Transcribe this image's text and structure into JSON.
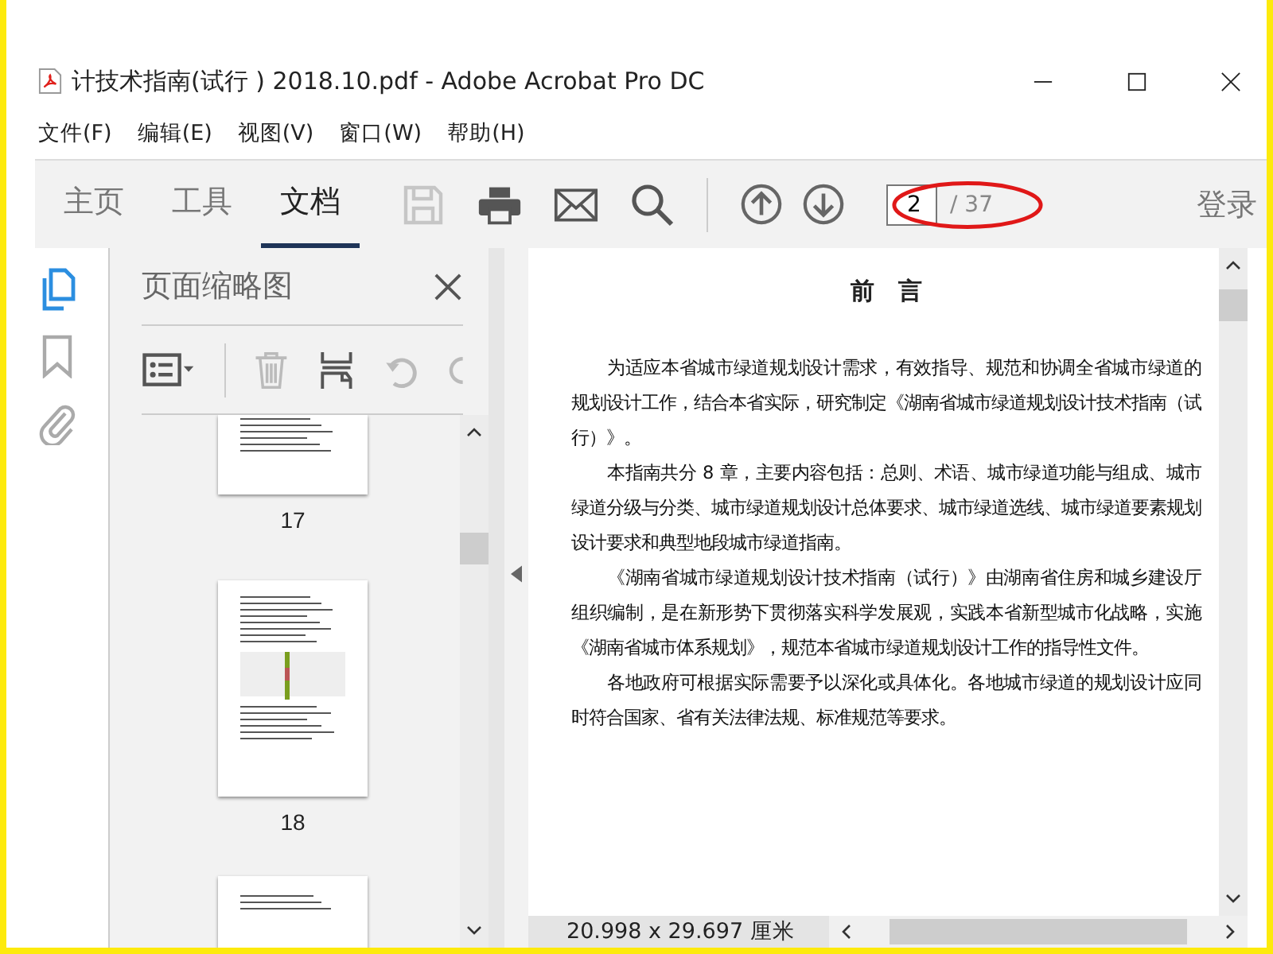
{
  "window": {
    "title": "计技术指南(试行 ) 2018.10.pdf - Adobe Acrobat Pro DC"
  },
  "menu": [
    "文件(F)",
    "编辑(E)",
    "视图(V)",
    "窗口(W)",
    "帮助(H)"
  ],
  "tabs": [
    {
      "label": "主页",
      "selected": false
    },
    {
      "label": "工具",
      "selected": false
    },
    {
      "label": "文档",
      "selected": true
    }
  ],
  "toolbar": [
    {
      "kind": "save",
      "disabled": true
    },
    {
      "kind": "print",
      "disabled": false
    },
    {
      "kind": "email",
      "disabled": false
    },
    {
      "kind": "search",
      "disabled": false
    }
  ],
  "navigation": [
    {
      "kind": "up"
    },
    {
      "kind": "down"
    }
  ],
  "page_field": {
    "value": "2",
    "total": "/ 37",
    "circled": true
  },
  "sign_in": "登录",
  "side_tools": [
    {
      "kind": "pages",
      "selected": true
    },
    {
      "kind": "bookmark",
      "selected": false
    },
    {
      "kind": "attachment",
      "selected": false
    }
  ],
  "thumbnail_panel": {
    "title": "页面缩略图",
    "tools": [
      {
        "kind": "options",
        "disabled": false
      },
      {
        "kind": "delete",
        "disabled": true
      },
      {
        "kind": "insert",
        "disabled": false
      },
      {
        "kind": "undo",
        "disabled": true
      },
      {
        "kind": "redo",
        "disabled": true
      }
    ],
    "thumbnails": [
      {
        "label": "17",
        "kind": "text"
      },
      {
        "label": "18",
        "kind": "figure"
      }
    ]
  },
  "document": {
    "heading": "前　言",
    "paragraphs": [
      "为适应本省城市绿道规划设计需求，有效指导、规范和协调全省城市绿道的规划设计工作，结合本省实际，研究制定《湖南省城市绿道规划设计技术指南（试行）》。",
      "本指南共分 8 章，主要内容包括：总则、术语、城市绿道功能与组成、城市绿道分级与分类、城市绿道规划设计总体要求、城市绿道选线、城市绿道要素规划设计要求和典型地段城市绿道指南。",
      "《湖南省城市绿道规划设计技术指南（试行）》由湖南省住房和城乡建设厅组织编制，是在新形势下贯彻落实科学发展观，实践本省新型城市化战略，实施《湖南省城市体系规划》，规范本省城市绿道规划设计工作的指导性文件。",
      "各地政府可根据实际需要予以深化或具体化。各地城市绿道的规划设计应同时符合国家、省有关法律法规、标准规范等要求。"
    ]
  },
  "status_bar": {
    "page_size": "20.998 x 29.697 厘米"
  }
}
